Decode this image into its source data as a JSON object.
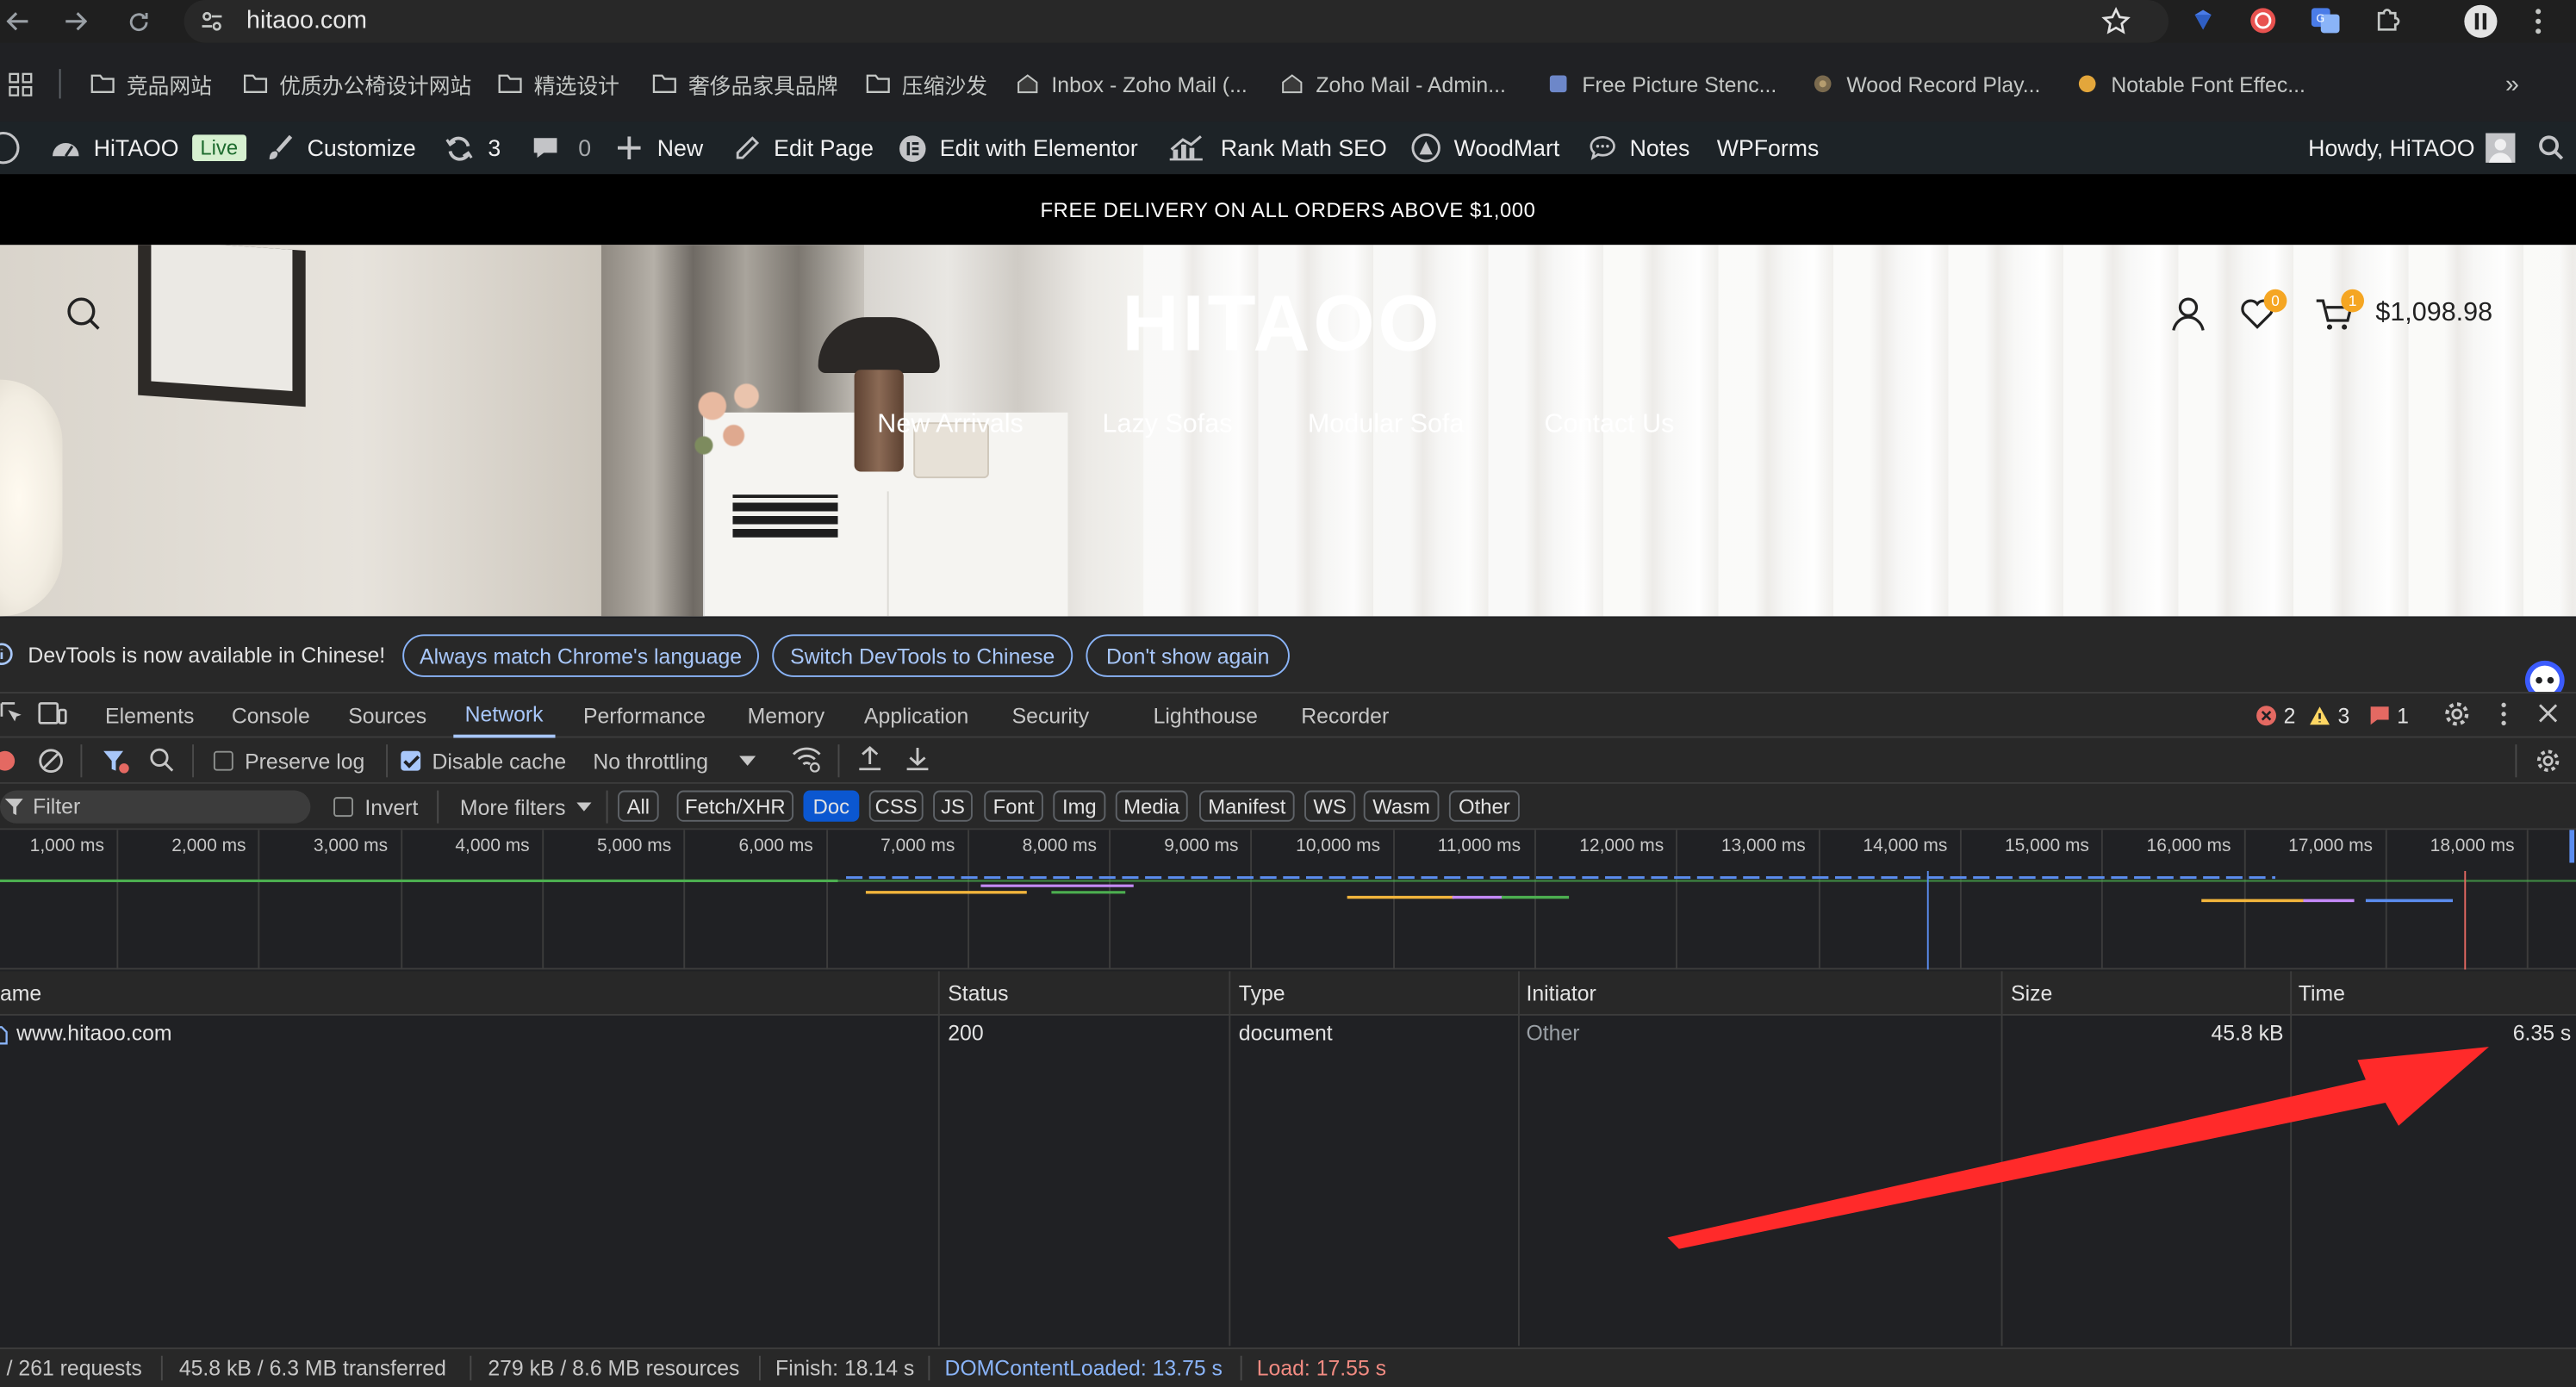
{
  "browser": {
    "url": "hitaoo.com",
    "bookmarks": [
      {
        "label": "竞品网站",
        "icon": "folder-icon"
      },
      {
        "label": "优质办公椅设计网站",
        "icon": "folder-icon"
      },
      {
        "label": "精选设计",
        "icon": "folder-icon"
      },
      {
        "label": "奢侈品家具品牌",
        "icon": "folder-icon"
      },
      {
        "label": "压缩沙发",
        "icon": "folder-icon"
      },
      {
        "label": "Inbox - Zoho Mail (...",
        "icon": "zoho-icon"
      },
      {
        "label": "Zoho Mail - Admin...",
        "icon": "zoho-icon"
      },
      {
        "label": "Free Picture Stenc...",
        "icon": "stencil-icon"
      },
      {
        "label": "Wood Record Play...",
        "icon": "wood-icon"
      },
      {
        "label": "Notable Font Effec...",
        "icon": "font-effect-icon"
      }
    ],
    "more_bookmarks": "»"
  },
  "wpbar": {
    "site": "HiTAOO",
    "live": "Live",
    "customize": "Customize",
    "updates": "3",
    "comments": "0",
    "new": "New",
    "edit_page": "Edit Page",
    "elementor": "Edit with Elementor",
    "rankmath": "Rank Math SEO",
    "woodmart": "WoodMart",
    "notes": "Notes",
    "wpforms": "WPForms",
    "howdy": "Howdy, HiTAOO"
  },
  "site": {
    "promo": "FREE DELIVERY ON ALL ORDERS ABOVE $1,000",
    "logo": "HITAOO",
    "nav": [
      "New Arrivals",
      "Lazy Sofas",
      "Modular Sofa",
      "Contact Us"
    ],
    "wishlist_count": "0",
    "cart_count": "1",
    "cart_total": "$1,098.98"
  },
  "devtools": {
    "info_text": "DevTools is now available in Chinese!",
    "info_buttons": [
      "Always match Chrome's language",
      "Switch DevTools to Chinese",
      "Don't show again"
    ],
    "tabs": [
      "Elements",
      "Console",
      "Sources",
      "Network",
      "Performance",
      "Memory",
      "Application",
      "Security",
      "Lighthouse",
      "Recorder"
    ],
    "active_tab": "Network",
    "errors": "2",
    "warnings": "3",
    "issues": "1",
    "toolbar": {
      "preserve_log": "Preserve log",
      "disable_cache": "Disable cache",
      "throttling": "No throttling"
    },
    "filter": {
      "placeholder": "Filter",
      "invert": "Invert",
      "more_filters": "More filters",
      "types": [
        "All",
        "Fetch/XHR",
        "Doc",
        "CSS",
        "JS",
        "Font",
        "Img",
        "Media",
        "Manifest",
        "WS",
        "Wasm",
        "Other"
      ],
      "active_type": "Doc"
    },
    "timeline_ticks": [
      "1,000 ms",
      "2,000 ms",
      "3,000 ms",
      "4,000 ms",
      "5,000 ms",
      "6,000 ms",
      "7,000 ms",
      "8,000 ms",
      "9,000 ms",
      "10,000 ms",
      "11,000 ms",
      "12,000 ms",
      "13,000 ms",
      "14,000 ms",
      "15,000 ms",
      "16,000 ms",
      "17,000 ms",
      "18,000 ms"
    ],
    "columns": [
      "ame",
      "Status",
      "Type",
      "Initiator",
      "Size",
      "Time"
    ],
    "rows": [
      {
        "name": "www.hitaoo.com",
        "status": "200",
        "type": "document",
        "initiator": "Other",
        "size": "45.8 kB",
        "time": "6.35 s"
      }
    ],
    "summary": {
      "requests": "/ 261 requests",
      "transferred": "45.8 kB / 6.3 MB transferred",
      "resources": "279 kB / 8.6 MB resources",
      "finish": "Finish: 18.14 s",
      "dom_content_loaded": "DOMContentLoaded: 13.75 s",
      "load": "Load: 17.55 s"
    }
  },
  "colors": {
    "accent": "#a8c7fa",
    "arrow": "#ff2a2a",
    "dom_line": "#5b8def",
    "load_line": "#e46962"
  }
}
